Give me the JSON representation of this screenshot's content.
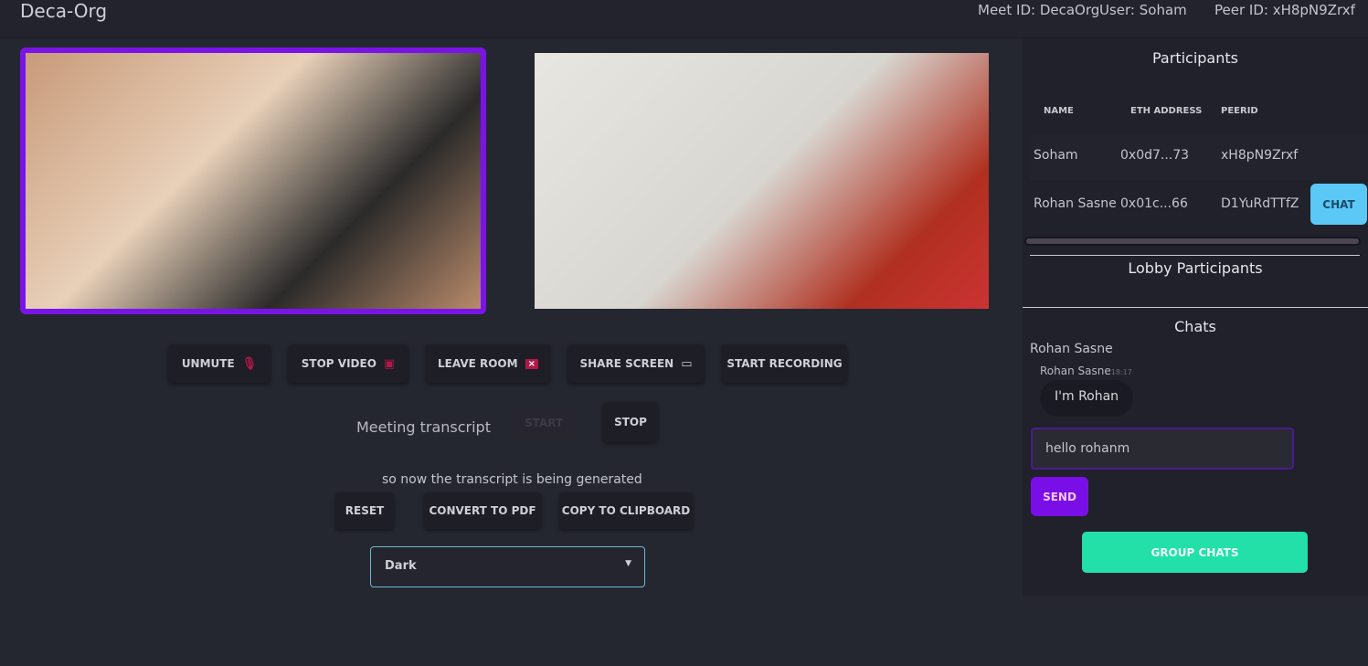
{
  "header": {
    "title": "Deca-Org",
    "meet_id": "Meet ID: DecaOrg",
    "user": "User: Soham",
    "peer_id": "Peer ID: xH8pN9Zrxf"
  },
  "controls": {
    "unmute": "UNMUTE",
    "stop_video": "STOP VIDEO",
    "leave_room": "LEAVE ROOM",
    "share_screen": "SHARE SCREEN",
    "start_recording": "START RECORDING"
  },
  "transcript": {
    "label": "Meeting transcript",
    "start": "START",
    "stop": "STOP",
    "text": "so now the transcript is being generated",
    "reset": "RESET",
    "pdf": "CONVERT TO PDF",
    "copy": "COPY TO CLIPBOARD",
    "theme": "Dark"
  },
  "participants": {
    "title": "Participants",
    "columns": [
      "NAME",
      "ETH ADDRESS",
      "PEERID"
    ],
    "rows": [
      {
        "name": "Soham",
        "eth": "0x0d7...73",
        "peer": "xH8pN9Zrxf"
      },
      {
        "name": "Rohan Sasne",
        "eth": "0x01c...66",
        "peer": "D1YuRdTTfZ",
        "action": "CHAT"
      }
    ]
  },
  "lobby": {
    "title": "Lobby Participants"
  },
  "chats": {
    "title": "Chats",
    "contact": "Rohan Sasne",
    "messages": [
      {
        "sender": "Rohan Sasne",
        "time": "18:17",
        "text": "I'm Rohan"
      }
    ],
    "input_value": "hello rohanm",
    "send": "SEND",
    "group": "GROUP CHATS"
  },
  "colors": {
    "accent": "#7a14e6",
    "chat": "#5bc8f5",
    "group": "#22e0a8"
  }
}
